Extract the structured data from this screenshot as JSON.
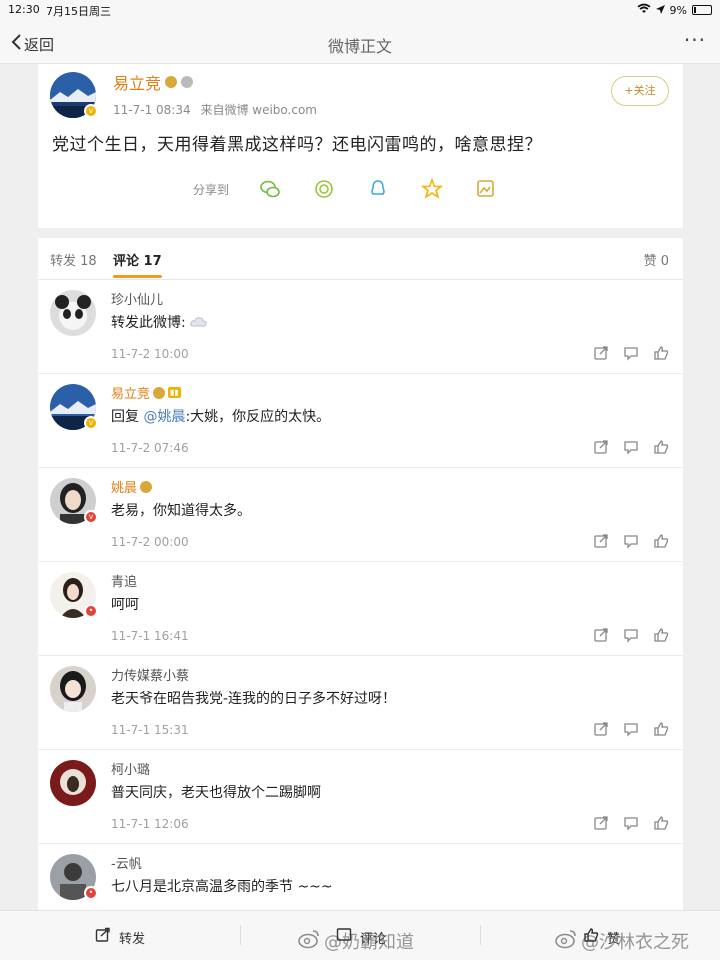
{
  "status_bar": {
    "time": "12:30",
    "date": "7月15日周三",
    "battery": "9%"
  },
  "nav": {
    "back_label": "返回",
    "title": "微博正文",
    "more": "···"
  },
  "post": {
    "author": "易立竞",
    "meta_date": "11-7-1 08:34",
    "meta_source": "来自微博 weibo.com",
    "follow_label": "+关注",
    "text": "党过个生日，天用得着黑成这样吗？还电闪雷鸣的，啥意思捏？",
    "share_label": "分享到"
  },
  "tabs": {
    "repost": "转发 18",
    "comment": "评论 17",
    "like": "赞 0"
  },
  "comments": [
    {
      "name": "珍小仙儿",
      "text": "转发此微博:",
      "time": "11-7-2 10:00"
    },
    {
      "name": "易立竞",
      "reply_prefix": "回复",
      "mention": "@姚晨",
      "text": ":大姚，你反应的太快。",
      "time": "11-7-2 07:46"
    },
    {
      "name": "姚晨",
      "text": "老易，你知道得太多。",
      "time": "11-7-2 00:00"
    },
    {
      "name": "青追",
      "text": "呵呵",
      "time": "11-7-1 16:41"
    },
    {
      "name": "力传媒蔡小蔡",
      "text": "老天爷在昭告我党-连我的的日子多不好过呀！",
      "time": "11-7-1 15:31"
    },
    {
      "name": "柯小璐",
      "text": "普天同庆，老天也得放个二踢脚啊",
      "time": "11-7-1 12:06"
    },
    {
      "name": "-云帆",
      "text": "七八月是北京高温多雨的季节 ~~~"
    }
  ],
  "bottom_bar": {
    "repost": "转发",
    "comment": "评论",
    "like": "赞"
  },
  "watermarks": {
    "left": "@奶霸知道",
    "right": "@沙林衣之死"
  },
  "colors": {
    "accent": "#e37f13",
    "mention": "#4a7dbb",
    "tab_underline": "#f29a1d"
  }
}
